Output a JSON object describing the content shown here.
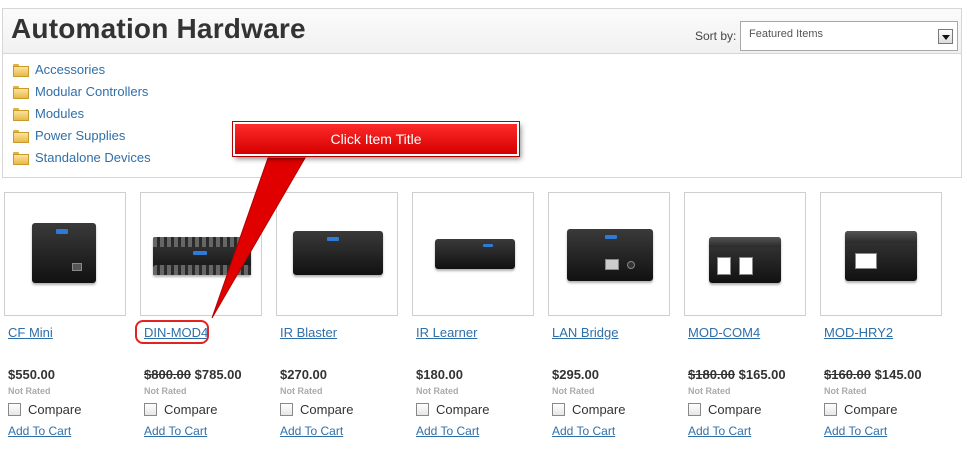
{
  "header": {
    "title": "Automation Hardware",
    "sort_label": "Sort by:",
    "sort_value": "Featured Items"
  },
  "categories": [
    {
      "label": "Accessories",
      "icon": "folder-icon"
    },
    {
      "label": "Modular Controllers",
      "icon": "folder-icon"
    },
    {
      "label": "Modules",
      "icon": "folder-icon"
    },
    {
      "label": "Power Supplies",
      "icon": "folder-icon"
    },
    {
      "label": "Standalone Devices",
      "icon": "folder-icon"
    }
  ],
  "products": [
    {
      "title": "CF Mini",
      "old_price": "",
      "price": "$550.00",
      "rating": "Not Rated",
      "compare": "Compare",
      "cart": "Add To Cart"
    },
    {
      "title": "DIN-MOD4",
      "old_price": "$800.00",
      "price": "$785.00",
      "rating": "Not Rated",
      "compare": "Compare",
      "cart": "Add To Cart"
    },
    {
      "title": "IR Blaster",
      "old_price": "",
      "price": "$270.00",
      "rating": "Not Rated",
      "compare": "Compare",
      "cart": "Add To Cart"
    },
    {
      "title": "IR Learner",
      "old_price": "",
      "price": "$180.00",
      "rating": "Not Rated",
      "compare": "Compare",
      "cart": "Add To Cart"
    },
    {
      "title": "LAN Bridge",
      "old_price": "",
      "price": "$295.00",
      "rating": "Not Rated",
      "compare": "Compare",
      "cart": "Add To Cart"
    },
    {
      "title": "MOD-COM4",
      "old_price": "$180.00",
      "price": "$165.00",
      "rating": "Not Rated",
      "compare": "Compare",
      "cart": "Add To Cart"
    },
    {
      "title": "MOD-HRY2",
      "old_price": "$160.00",
      "price": "$145.00",
      "rating": "Not Rated",
      "compare": "Compare",
      "cart": "Add To Cart"
    }
  ],
  "annotation": {
    "callout_text": "Click Item Title",
    "color": "#e00000"
  },
  "colors": {
    "link": "#2f6fa8",
    "callout": "#e00000"
  }
}
